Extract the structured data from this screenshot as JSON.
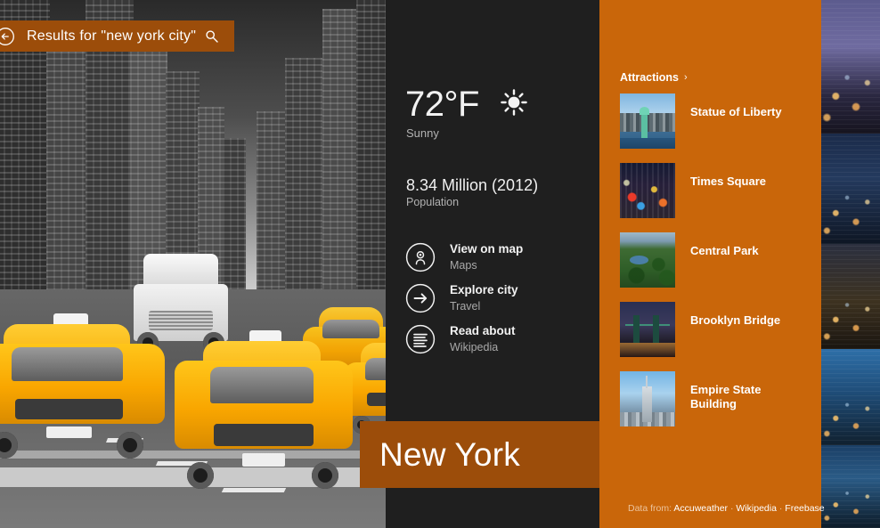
{
  "search": {
    "label": "Results for \"new york city\"",
    "back_icon": "back-arrow-circle-icon",
    "search_icon": "magnifier-icon"
  },
  "city": {
    "title": "New York"
  },
  "details": {
    "weather": {
      "temperature": "72°F",
      "condition": "Sunny",
      "icon": "sun-icon"
    },
    "population": {
      "value": "8.34 Million (2012)",
      "label": "Population"
    },
    "actions": [
      {
        "title": "View on map",
        "subtitle": "Maps",
        "icon": "map-pin-circle-icon"
      },
      {
        "title": "Explore city",
        "subtitle": "Travel",
        "icon": "arrow-right-circle-icon"
      },
      {
        "title": "Read about",
        "subtitle": "Wikipedia",
        "icon": "article-lines-circle-icon"
      }
    ]
  },
  "attractions": {
    "header": "Attractions",
    "chevron": "›",
    "items": [
      {
        "name": "Statue of Liberty",
        "thumb": "statue-of-liberty-thumbnail"
      },
      {
        "name": "Times Square",
        "thumb": "times-square-thumbnail"
      },
      {
        "name": "Central Park",
        "thumb": "central-park-thumbnail"
      },
      {
        "name": "Brooklyn Bridge",
        "thumb": "brooklyn-bridge-thumbnail"
      },
      {
        "name": "Empire State Building",
        "thumb": "empire-state-building-thumbnail"
      }
    ],
    "footer": {
      "label": "Data from:",
      "sources": [
        "Accuweather",
        "Wikipedia",
        "Freebase"
      ],
      "separator": "·"
    }
  },
  "colors": {
    "accent_orange": "#c9660a",
    "deep_orange": "#9c4d0a",
    "panel_dark": "#1f1f1f",
    "text_primary": "#ffffff",
    "text_secondary": "#b2b2b2"
  }
}
